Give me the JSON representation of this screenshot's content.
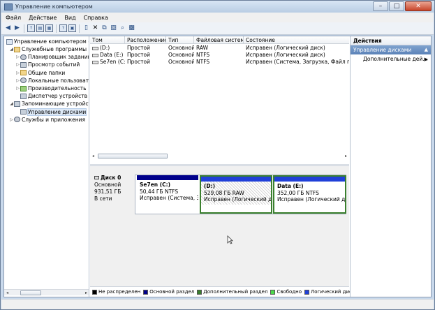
{
  "window": {
    "title": "Управление компьютером",
    "minimize": "–",
    "maximize": "□",
    "close": "✕"
  },
  "menu": [
    "Файл",
    "Действие",
    "Вид",
    "Справка"
  ],
  "toolbar": [
    "back-icon",
    "forward-icon",
    "up-folder-icon",
    "show-tree-icon",
    "properties-icon",
    "help-icon",
    "refresh-icon",
    "delete-icon",
    "new-icon",
    "open-icon",
    "search-icon",
    "zoom-icon"
  ],
  "tree": {
    "root": "Управление компьютером (л",
    "items": [
      {
        "label": "Служебные программы",
        "level": 1,
        "expander": "◢"
      },
      {
        "label": "Планировщик заданий",
        "level": 2,
        "expander": "▷"
      },
      {
        "label": "Просмотр событий",
        "level": 2,
        "expander": "▷"
      },
      {
        "label": "Общие папки",
        "level": 2,
        "expander": "▷"
      },
      {
        "label": "Локальные пользовате",
        "level": 2,
        "expander": "▷"
      },
      {
        "label": "Производительность",
        "level": 2,
        "expander": "▷"
      },
      {
        "label": "Диспетчер устройств",
        "level": 2,
        "expander": ""
      },
      {
        "label": "Запоминающие устройст",
        "level": 1,
        "expander": "◢"
      },
      {
        "label": "Управление дисками",
        "level": 2,
        "expander": ""
      },
      {
        "label": "Службы и приложения",
        "level": 1,
        "expander": "▷"
      }
    ]
  },
  "volumes": {
    "headers": [
      "Том",
      "Расположение",
      "Тип",
      "Файловая система",
      "Состояние"
    ],
    "rows": [
      [
        "(D:)",
        "Простой",
        "Основной",
        "RAW",
        "Исправен (Логический диск)"
      ],
      [
        "Data (E:)",
        "Простой",
        "Основной",
        "NTFS",
        "Исправен (Логический диск)"
      ],
      [
        "Se7en (C:)",
        "Простой",
        "Основной",
        "NTFS",
        "Исправен (Система, Загрузка, Файл подка"
      ]
    ]
  },
  "disk": {
    "name": "Диск 0",
    "type": "Основной",
    "size": "931,51 ГБ",
    "status": "В сети",
    "partitions": [
      {
        "name": "Se7en (C:)",
        "size": "50,44 ГБ NTFS",
        "status": "Исправен (Система, За"
      },
      {
        "name": "(D:)",
        "size": "529,08 ГБ RAW",
        "status": "Исправен (Логический диск"
      },
      {
        "name": "Data (E:)",
        "size": "352,00 ГБ NTFS",
        "status": "Исправен (Логический диск"
      }
    ]
  },
  "legend": [
    {
      "label": "Не распределен",
      "color": "#000000"
    },
    {
      "label": "Основной раздел",
      "color": "#00008b"
    },
    {
      "label": "Дополнительный раздел",
      "color": "#3a7f2e"
    },
    {
      "label": "Свободно",
      "color": "#4cd94c"
    },
    {
      "label": "Логический диск",
      "color": "#2040d8"
    }
  ],
  "actions": {
    "header": "Действия",
    "section": "Управление дисками",
    "item": "Дополнительные дей..."
  },
  "glyphs": {
    "arrow_left": "◂",
    "arrow_right": "▸",
    "caret_up": "▲",
    "caret_right": "▶"
  }
}
